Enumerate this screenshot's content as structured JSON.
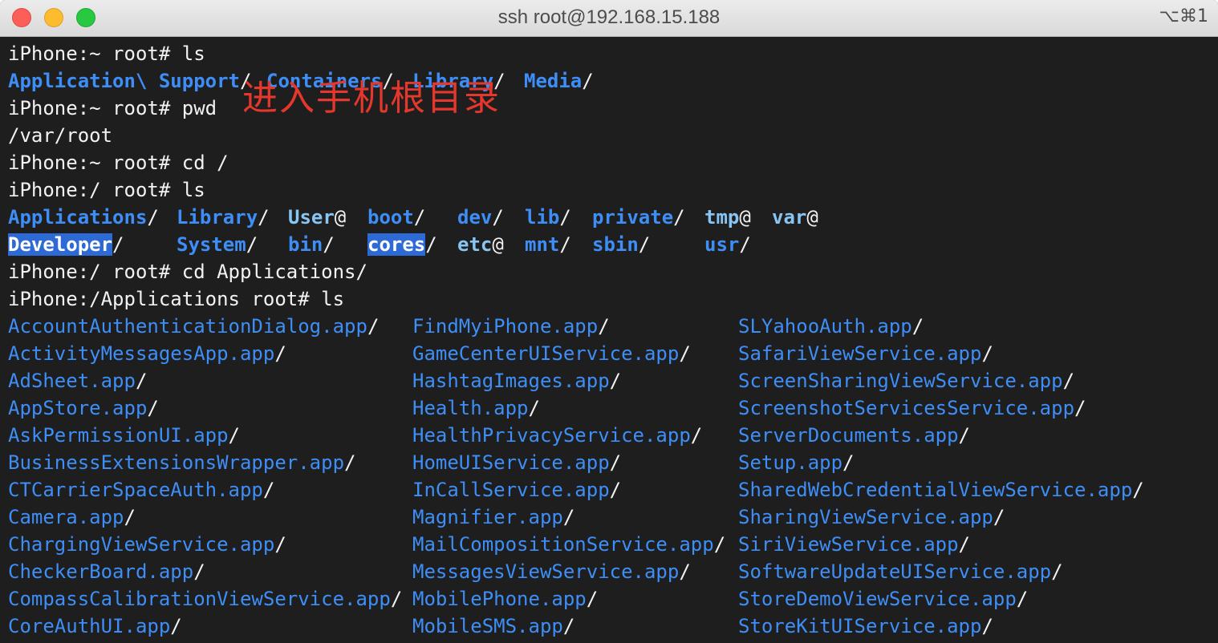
{
  "window": {
    "title": "ssh root@192.168.15.188",
    "shortcut": "⌥⌘1"
  },
  "annotation": "进入手机根目录",
  "terminal": {
    "cmd1": "iPhone:~ root# ls",
    "home_ls": [
      {
        "name": "Application\\ Support",
        "suffix": "/"
      },
      {
        "name": "Containers",
        "suffix": "/"
      },
      {
        "name": "Library",
        "suffix": "/"
      },
      {
        "name": "Media",
        "suffix": "/"
      }
    ],
    "cmd2": "iPhone:~ root# pwd",
    "pwd_out": "/var/root",
    "cmd3": "iPhone:~ root# cd /",
    "cmd4": "iPhone:/ root# ls",
    "root_ls_row1": [
      {
        "name": "Applications",
        "suffix": "/"
      },
      {
        "name": "Library",
        "suffix": "/"
      },
      {
        "name": "User",
        "suffix": "@"
      },
      {
        "name": "boot",
        "suffix": "/"
      },
      {
        "name": "dev",
        "suffix": "/"
      },
      {
        "name": "lib",
        "suffix": "/"
      },
      {
        "name": "private",
        "suffix": "/"
      },
      {
        "name": "tmp",
        "suffix": "@"
      },
      {
        "name": "var",
        "suffix": "@"
      }
    ],
    "root_ls_row2": [
      {
        "name": "Developer",
        "suffix": "/"
      },
      {
        "name": "System",
        "suffix": "/"
      },
      {
        "name": "bin",
        "suffix": "/"
      },
      {
        "name": "cores",
        "suffix": "/"
      },
      {
        "name": "etc",
        "suffix": "@"
      },
      {
        "name": "mnt",
        "suffix": "/"
      },
      {
        "name": "sbin",
        "suffix": "/"
      },
      {
        "name": "usr",
        "suffix": "/"
      }
    ],
    "cmd5": "iPhone:/ root# cd Applications/",
    "cmd6": "iPhone:/Applications root# ls",
    "apps_col1": [
      "AccountAuthenticationDialog.app",
      "ActivityMessagesApp.app",
      "AdSheet.app",
      "AppStore.app",
      "AskPermissionUI.app",
      "BusinessExtensionsWrapper.app",
      "CTCarrierSpaceAuth.app",
      "Camera.app",
      "ChargingViewService.app",
      "CheckerBoard.app",
      "CompassCalibrationViewService.app",
      "CoreAuthUI.app"
    ],
    "apps_col2": [
      "FindMyiPhone.app",
      "GameCenterUIService.app",
      "HashtagImages.app",
      "Health.app",
      "HealthPrivacyService.app",
      "HomeUIService.app",
      "InCallService.app",
      "Magnifier.app",
      "MailCompositionService.app",
      "MessagesViewService.app",
      "MobilePhone.app",
      "MobileSMS.app"
    ],
    "apps_col3": [
      "SLYahooAuth.app",
      "SafariViewService.app",
      "ScreenSharingViewService.app",
      "ScreenshotServicesService.app",
      "ServerDocuments.app",
      "Setup.app",
      "SharedWebCredentialViewService.app",
      "SharingViewService.app",
      "SiriViewService.app",
      "SoftwareUpdateUIService.app",
      "StoreDemoViewService.app",
      "StoreKitUIService.app"
    ],
    "colors": {
      "background": "#1e1e1e",
      "text": "#f2f2f2",
      "directory": "#3e8ef7",
      "symlink": "#88c5f2",
      "selection": "#2d6ad6",
      "annotation": "#e5372c"
    }
  }
}
